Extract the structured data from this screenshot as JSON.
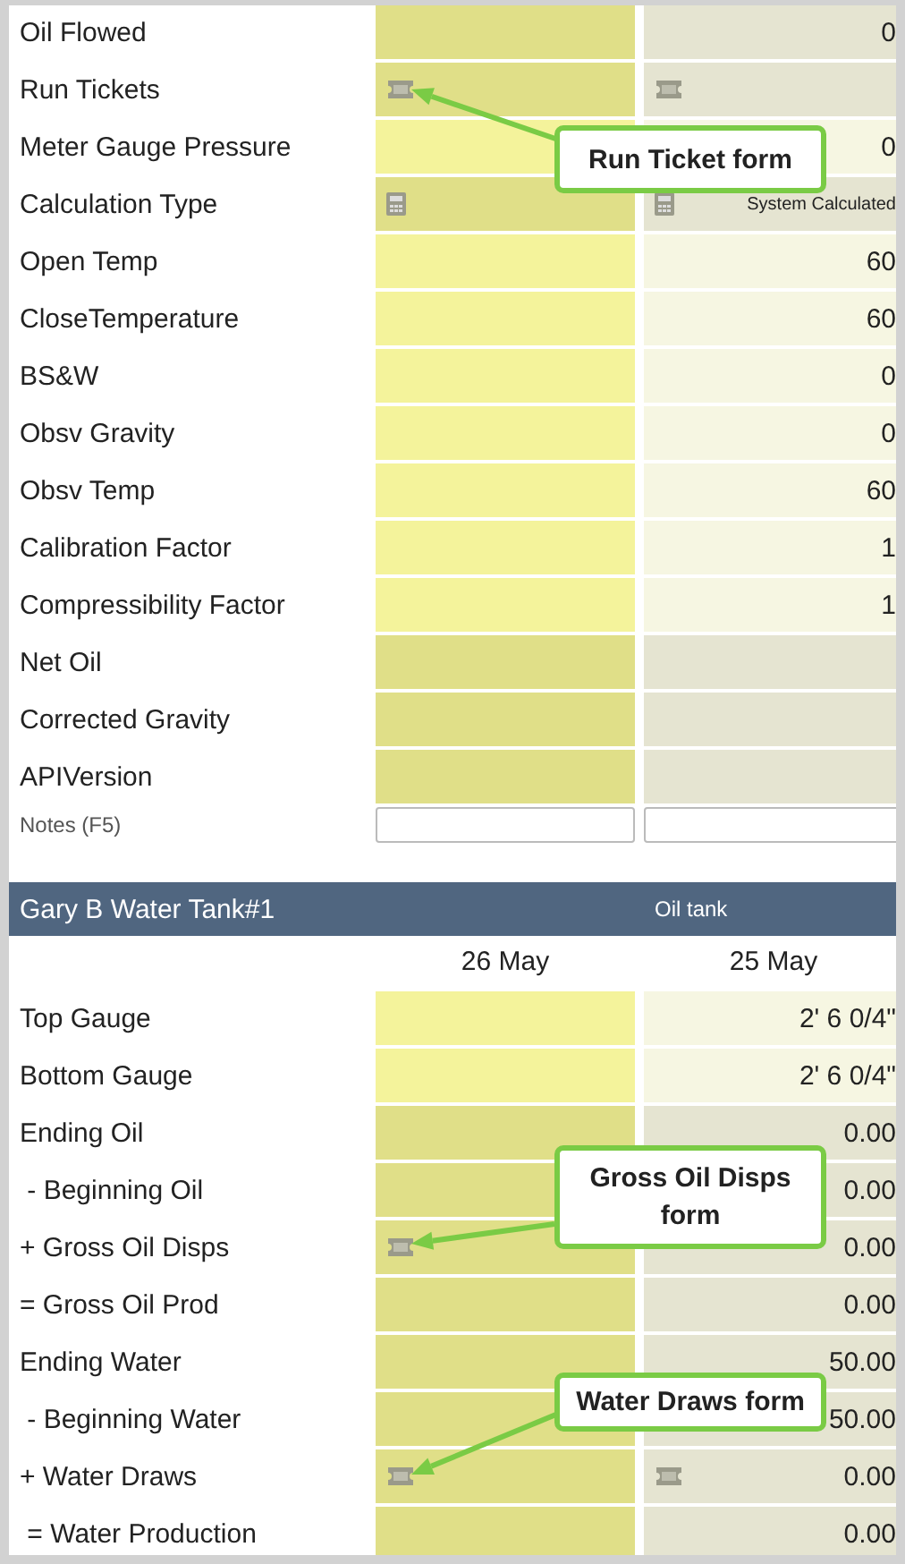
{
  "sections": [
    {
      "rows": [
        {
          "kind": "field",
          "label": "Oil Flowed",
          "cells": [
            {
              "editable": false
            },
            {
              "editable": false,
              "value": "0"
            }
          ]
        },
        {
          "kind": "field",
          "label": "Run Tickets",
          "cells": [
            {
              "editable": false,
              "kind": "ticket"
            },
            {
              "editable": false,
              "kind": "ticket"
            }
          ],
          "callout": "Run Ticket form"
        },
        {
          "kind": "field",
          "label": "Meter Gauge Pressure",
          "cells": [
            {
              "editable": true
            },
            {
              "editable": true,
              "value": "0"
            }
          ]
        },
        {
          "kind": "field",
          "label": "Calculation Type",
          "cells": [
            {
              "editable": false,
              "kind": "calculator"
            },
            {
              "editable": false,
              "kind": "calculator",
              "caption": "System Calculated"
            }
          ]
        },
        {
          "kind": "field",
          "label": "Open Temp",
          "cells": [
            {
              "editable": true
            },
            {
              "editable": true,
              "value": "60"
            }
          ]
        },
        {
          "kind": "field",
          "label": "CloseTemperature",
          "cells": [
            {
              "editable": true
            },
            {
              "editable": true,
              "value": "60"
            }
          ]
        },
        {
          "kind": "field",
          "label": "BS&W",
          "cells": [
            {
              "editable": true
            },
            {
              "editable": true,
              "value": "0"
            }
          ]
        },
        {
          "kind": "field",
          "label": "Obsv Gravity",
          "cells": [
            {
              "editable": true
            },
            {
              "editable": true,
              "value": "0"
            }
          ]
        },
        {
          "kind": "field",
          "label": "Obsv Temp",
          "cells": [
            {
              "editable": true
            },
            {
              "editable": true,
              "value": "60"
            }
          ]
        },
        {
          "kind": "field",
          "label": "Calibration Factor",
          "cells": [
            {
              "editable": true
            },
            {
              "editable": true,
              "value": "1"
            }
          ]
        },
        {
          "kind": "field",
          "label": "Compressibility Factor",
          "cells": [
            {
              "editable": true
            },
            {
              "editable": true,
              "value": "1"
            }
          ]
        },
        {
          "kind": "field",
          "label": "Net Oil",
          "cells": [
            {
              "editable": false
            },
            {
              "editable": false
            }
          ]
        },
        {
          "kind": "field",
          "label": "Corrected Gravity",
          "cells": [
            {
              "editable": false
            },
            {
              "editable": false
            }
          ]
        },
        {
          "kind": "field",
          "label": "APIVersion",
          "cells": [
            {
              "editable": false
            },
            {
              "editable": false
            }
          ]
        },
        {
          "kind": "notes",
          "label": "Notes (F5)",
          "cells": [
            {
              "kind": "notes"
            },
            {
              "kind": "notes"
            }
          ]
        }
      ]
    },
    {
      "header": {
        "title": "Gary B Water Tank#1",
        "subtitle": "Oil tank"
      },
      "dates": [
        "26 May",
        "25 May"
      ],
      "rows": [
        {
          "kind": "field",
          "label": "Top Gauge",
          "cells": [
            {
              "editable": true
            },
            {
              "editable": true,
              "value": "2' 6 0/4\""
            }
          ]
        },
        {
          "kind": "field",
          "label": "Bottom Gauge",
          "cells": [
            {
              "editable": true
            },
            {
              "editable": true,
              "value": "2' 6 0/4\""
            }
          ]
        },
        {
          "kind": "field",
          "label": "Ending Oil",
          "cells": [
            {
              "editable": false
            },
            {
              "editable": false,
              "value": "0.00"
            }
          ]
        },
        {
          "kind": "field",
          "label": " - Beginning Oil",
          "cells": [
            {
              "editable": false
            },
            {
              "editable": false,
              "value": "0.00"
            }
          ]
        },
        {
          "kind": "field",
          "label": "+ Gross Oil Disps",
          "cells": [
            {
              "editable": false,
              "kind": "ticket"
            },
            {
              "editable": false,
              "value": "0.00"
            }
          ],
          "callout": "Gross Oil Disps form"
        },
        {
          "kind": "field",
          "label": "= Gross Oil Prod",
          "cells": [
            {
              "editable": false
            },
            {
              "editable": false,
              "value": "0.00"
            }
          ]
        },
        {
          "kind": "field",
          "label": "Ending Water",
          "cells": [
            {
              "editable": false
            },
            {
              "editable": false,
              "value": "50.00"
            }
          ]
        },
        {
          "kind": "field",
          "label": " - Beginning Water",
          "cells": [
            {
              "editable": false
            },
            {
              "editable": false,
              "value": "50.00"
            }
          ]
        },
        {
          "kind": "field",
          "label": "+ Water Draws",
          "cells": [
            {
              "editable": false,
              "kind": "ticket"
            },
            {
              "editable": false,
              "kind": "ticket",
              "value": "0.00"
            }
          ],
          "callout": "Water Draws form"
        },
        {
          "kind": "field",
          "label": " = Water Production",
          "cells": [
            {
              "editable": false
            },
            {
              "editable": false,
              "value": "0.00"
            }
          ]
        }
      ]
    }
  ]
}
